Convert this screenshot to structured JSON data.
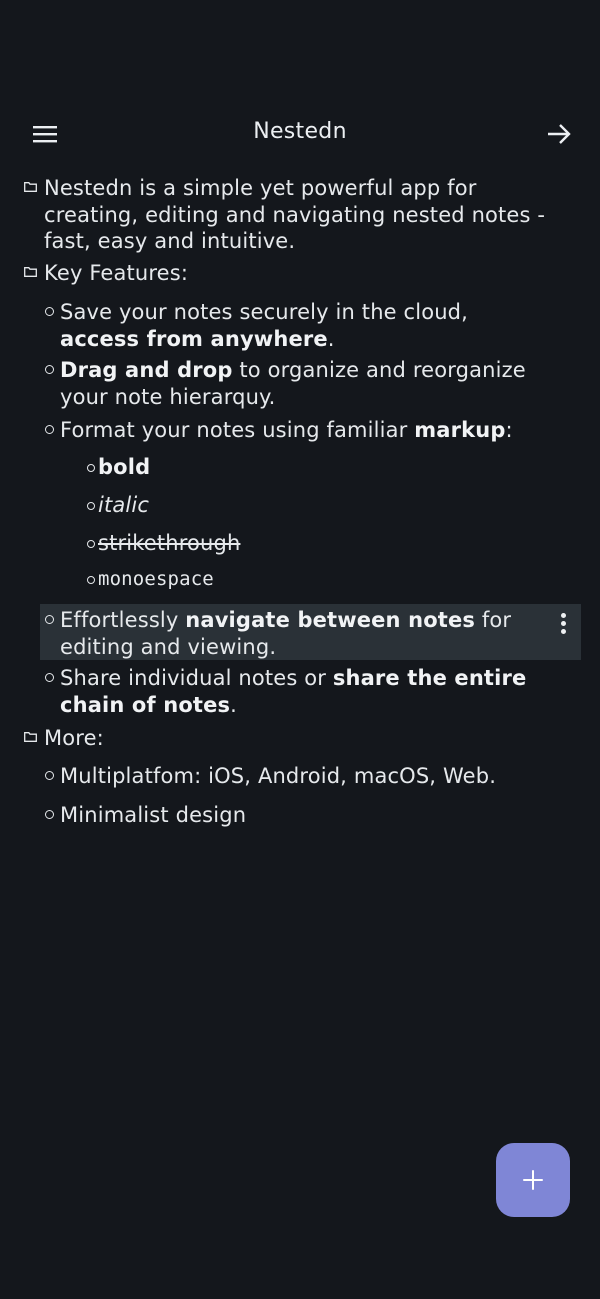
{
  "app_bar": {
    "title": "Nestedn",
    "menu_icon": "hamburger-menu-icon",
    "forward_icon": "arrow-right-icon"
  },
  "notes": {
    "intro": "Nestedn is a simple yet powerful app for creating, editing and navigating nested notes - fast, easy and intuitive.",
    "key_features": "Key Features:",
    "cloud_a": "Save your notes securely in the cloud, ",
    "cloud_b": "access from anywhere",
    "cloud_c": ".",
    "drag_a": "Drag and drop",
    "drag_b": " to organize and reorganize your note hierarquy.",
    "format_a": "Format your notes using familiar ",
    "format_b": "markup",
    "format_c": ":",
    "bold": "bold",
    "italic": "italic",
    "strikethrough": "strikethrough",
    "monospace": "monoespace",
    "navigate_a": "Effortlessly ",
    "navigate_b": "navigate between notes",
    "navigate_c": " for editing and viewing.",
    "share_a": "Share individual notes or ",
    "share_b": "share the entire chain of notes",
    "share_c": ".",
    "more": "More:",
    "multiplatform": "Multiplatfom: iOS, Android, macOS, Web.",
    "minimalist": "Minimalist design"
  },
  "icons": {
    "folder": "folder-icon",
    "bullet": "circle-bullet-icon",
    "more": "vertical-dots-icon",
    "add": "plus-icon"
  },
  "colors": {
    "background": "#14171c",
    "text": "#e6e9ec",
    "selected_row": "#2a3137",
    "fab": "#7f86d6"
  }
}
